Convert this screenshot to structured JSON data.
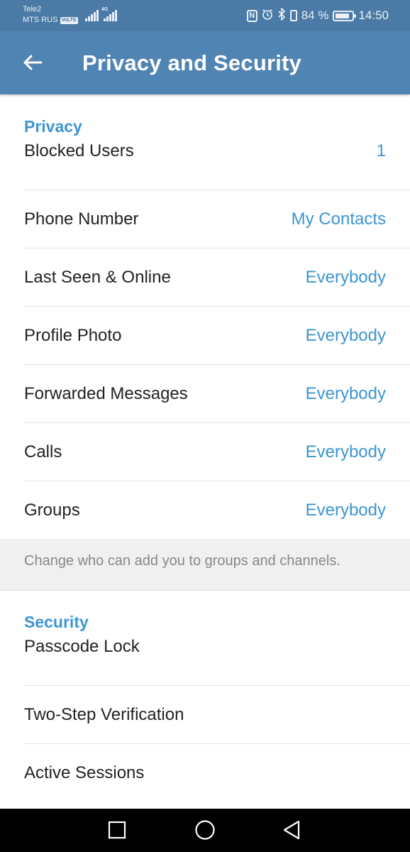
{
  "status_bar": {
    "carrier_1": "Tele2",
    "carrier_2": "MTS RUS",
    "volte": "VoLTE",
    "network": "4G",
    "battery": "84 %",
    "battery_level": 0.84,
    "time": "14:50",
    "icons": [
      "nfc-icon",
      "alarm-icon",
      "bluetooth-icon",
      "vibrate-icon",
      "battery-icon"
    ]
  },
  "app_bar": {
    "title": "Privacy and Security",
    "back_icon": "arrow-left-icon",
    "color": "#5084b3"
  },
  "privacy": {
    "header": "Privacy",
    "items": [
      {
        "label": "Blocked Users",
        "value": "1"
      },
      {
        "label": "Phone Number",
        "value": "My Contacts"
      },
      {
        "label": "Last Seen & Online",
        "value": "Everybody"
      },
      {
        "label": "Profile Photo",
        "value": "Everybody"
      },
      {
        "label": "Forwarded Messages",
        "value": "Everybody"
      },
      {
        "label": "Calls",
        "value": "Everybody"
      },
      {
        "label": "Groups",
        "value": "Everybody"
      }
    ],
    "info": "Change who can add you to groups and channels."
  },
  "security": {
    "header": "Security",
    "items": [
      {
        "label": "Passcode Lock"
      },
      {
        "label": "Two-Step Verification"
      },
      {
        "label": "Active Sessions"
      }
    ]
  },
  "nav_bar": {
    "icons": [
      "recents-square-icon",
      "home-circle-icon",
      "back-triangle-icon"
    ]
  },
  "colors": {
    "accent": "#3d95d2",
    "status_bar": "#4a7aa5",
    "nav_bar": "#000000"
  }
}
